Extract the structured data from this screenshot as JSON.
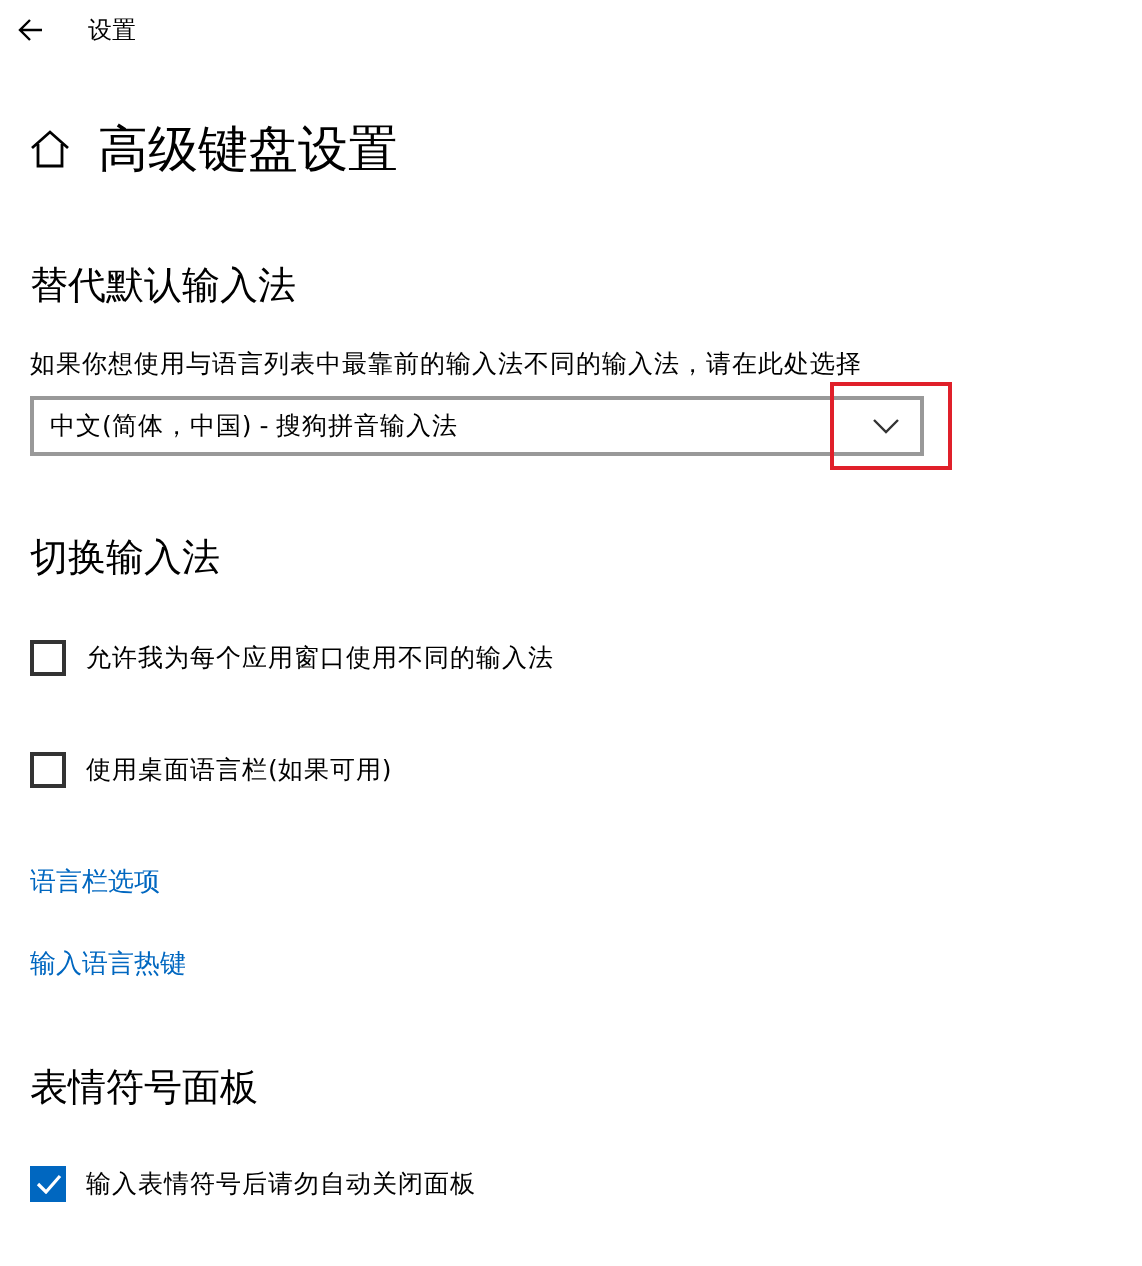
{
  "window": {
    "title": "设置"
  },
  "page": {
    "title": "高级键盘设置"
  },
  "sections": [
    {
      "title": "替代默认输入法",
      "items": [
        {
          "kind": "description",
          "text": "如果你想使用与语言列表中最靠前的输入法不同的输入法，请在此处选择"
        },
        {
          "kind": "dropdown",
          "value": "中文(简体，中国) - 搜狗拼音输入法",
          "highlighted": true
        }
      ]
    },
    {
      "title": "切换输入法",
      "items": [
        {
          "kind": "checkbox",
          "label": "允许我为每个应用窗口使用不同的输入法",
          "checked": false
        },
        {
          "kind": "checkbox",
          "label": "使用桌面语言栏(如果可用)",
          "checked": false
        },
        {
          "kind": "link",
          "text": "语言栏选项"
        },
        {
          "kind": "link",
          "text": "输入语言热键"
        }
      ]
    },
    {
      "title": "表情符号面板",
      "items": [
        {
          "kind": "checkbox",
          "label": "输入表情符号后请勿自动关闭面板",
          "checked": true
        }
      ]
    }
  ]
}
